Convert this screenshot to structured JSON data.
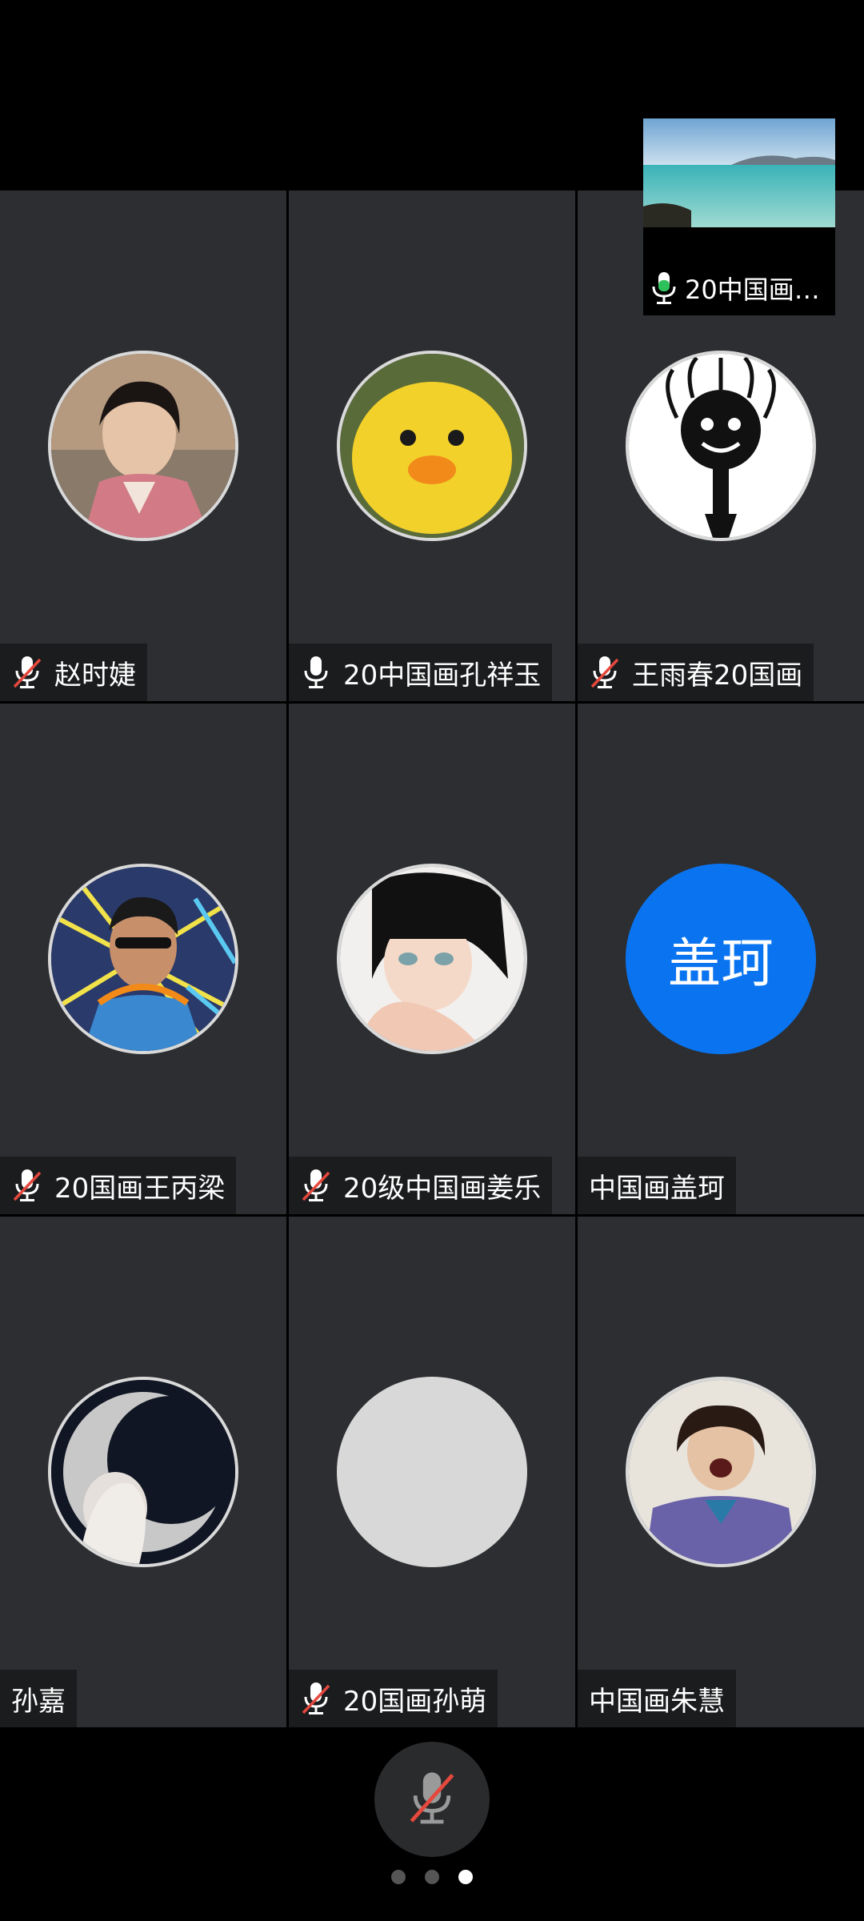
{
  "preview": {
    "label": "20中国画…",
    "mic_state": "active"
  },
  "participants": [
    {
      "name": "赵时婕",
      "mic": "muted",
      "avatar": "photo-woman-hanfu"
    },
    {
      "name": "20中国画孔祥玉",
      "mic": "on",
      "avatar": "photo-yellow-duck"
    },
    {
      "name": "王雨春20国画",
      "mic": "muted",
      "avatar": "cartoon-dark-figure"
    },
    {
      "name": "20国画王丙梁",
      "mic": "muted",
      "avatar": "cartoon-sunglasses-man"
    },
    {
      "name": "20级中国画姜乐",
      "mic": "muted",
      "avatar": "anime-girl"
    },
    {
      "name": "中国画盖珂",
      "mic": "none",
      "avatar_text": "盖珂",
      "avatar_color": "#0a74f0"
    },
    {
      "name": "孙嘉",
      "mic": "none",
      "avatar": "photo-moon-silhouette"
    },
    {
      "name": "20国画孙萌",
      "mic": "muted",
      "avatar": "blank-gray"
    },
    {
      "name": "中国画朱慧",
      "mic": "none",
      "avatar": "photo-girl-shouting"
    }
  ],
  "bottom": {
    "mic_button": "microphone-muted-icon",
    "pages": 3,
    "active_page": 3
  }
}
